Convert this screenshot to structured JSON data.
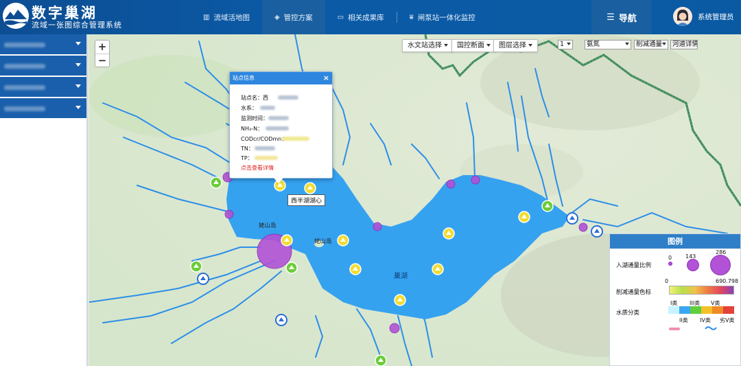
{
  "header": {
    "title": "数字巢湖",
    "subtitle": "流域一张图综合管理系统",
    "nav": [
      {
        "icon": "map-icon",
        "label": "流域活地图"
      },
      {
        "icon": "cube-icon",
        "label": "管控方案"
      },
      {
        "icon": "folder-icon",
        "label": "相关成果库"
      },
      {
        "icon": "gate-icon",
        "label": "闸泵站一体化监控"
      }
    ],
    "nav_main_label": "导航",
    "user_name": "系统管理员"
  },
  "map_controls": {
    "zoom_in": "+",
    "zoom_out": "−"
  },
  "toolbar": {
    "hydro_station": "水文站选择",
    "national_section": "国控断面",
    "layer_select": "图层选择",
    "day_value": "1",
    "factor_value": "氨氮",
    "mode_value": "削减通量",
    "detail_button": "河道详情"
  },
  "popup": {
    "title": "站点信息",
    "close": "×",
    "rows": [
      "站点名：西",
      "水系：",
      "监测时间：",
      "NH₃-N：",
      "CODcr/CODmn：",
      "TN：",
      "TP："
    ],
    "link": "点击查看详情"
  },
  "tooltip": "西半湖湖心",
  "map_labels": {
    "lake": "巢湖",
    "island1": "姥山岛",
    "island2": "姥山岛"
  },
  "legend": {
    "title": "图例",
    "inflow_label": "入湖通量比例",
    "inflow_values": [
      "0",
      "143",
      "286"
    ],
    "reduction_label": "削减通量色标",
    "reduction_min": "0",
    "reduction_max": "690.798",
    "quality_label": "水质分类",
    "classes_top": [
      "I类",
      "III类",
      "V类"
    ],
    "classes_bottom": [
      "II类",
      "IV类",
      "劣V类"
    ],
    "colors": {
      "class1": "#c9f2ff",
      "class2": "#3ba7f2",
      "class3": "#5fcf3b",
      "class4": "#f2c12a",
      "class5": "#f08a26",
      "class6": "#e4413a"
    }
  }
}
